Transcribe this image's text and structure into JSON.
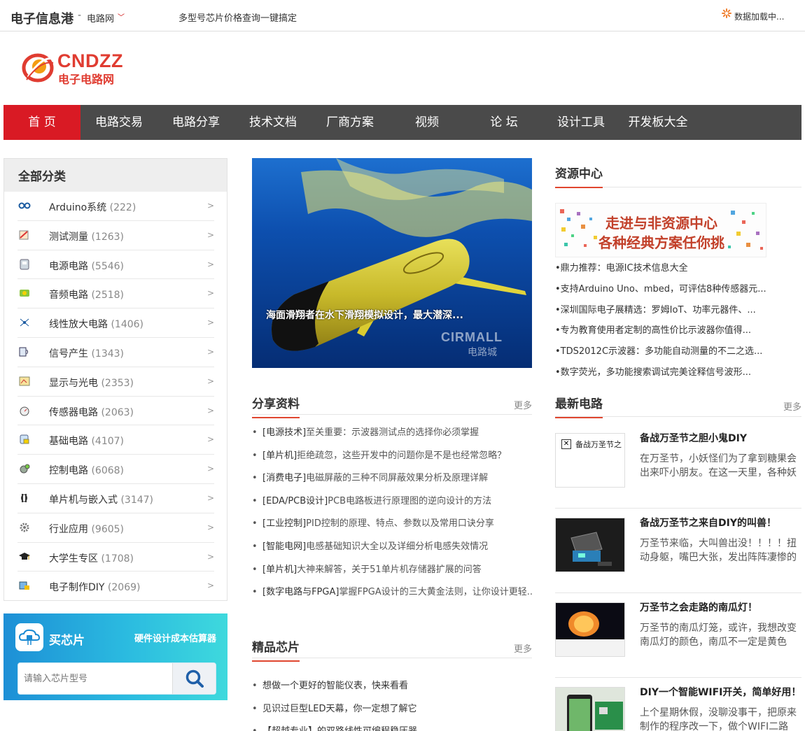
{
  "topbar": {
    "brand": "电子信息港",
    "separator": "-",
    "sub": "电路网",
    "promo": "多型号芯片价格查询一键搞定",
    "loading": "数据加载中..."
  },
  "logo": {
    "en": "CNDZZ",
    "cn": "电子电路网"
  },
  "nav": [
    "首 页",
    "电路交易",
    "电路分享",
    "技术文档",
    "厂商方案",
    "视频",
    "论 坛",
    "设计工具",
    "开发板大全"
  ],
  "categories": {
    "title": "全部分类",
    "items": [
      {
        "name": "Arduino系统",
        "count": "(222)"
      },
      {
        "name": "测试测量",
        "count": "(1263)"
      },
      {
        "name": "电源电路",
        "count": "(5546)"
      },
      {
        "name": "音频电路",
        "count": "(2518)"
      },
      {
        "name": "线性放大电路",
        "count": "(1406)"
      },
      {
        "name": "信号产生",
        "count": "(1343)"
      },
      {
        "name": "显示与光电",
        "count": "(2353)"
      },
      {
        "name": "传感器电路",
        "count": "(2063)"
      },
      {
        "name": "基础电路",
        "count": "(4107)"
      },
      {
        "name": "控制电路",
        "count": "(6068)"
      },
      {
        "name": "单片机与嵌入式",
        "count": "(3147)"
      },
      {
        "name": "行业应用",
        "count": "(9605)"
      },
      {
        "name": "大学生专区",
        "count": "(1708)"
      },
      {
        "name": "电子制作DIY",
        "count": "(2069)"
      }
    ],
    "arrow": ">"
  },
  "chips": {
    "title": "买芯片",
    "subtitle": "硬件设计成本估算器",
    "placeholder": "请输入芯片型号"
  },
  "hero": {
    "caption": "海面滑翔者在水下滑翔模拟设计，最大潜深...",
    "watermark_en": "CIRMALL",
    "watermark_cn": "电路城"
  },
  "share": {
    "title": "分享资料",
    "more": "更多",
    "items": [
      {
        "cat": "[电源技术]",
        "text": "至关重要：示波器测试点的选择你必须掌握"
      },
      {
        "cat": "[单片机]",
        "text": "拒绝疏忽，这些开发中的问题你是不是也经常忽略？"
      },
      {
        "cat": "[消费电子]",
        "text": "电磁屏蔽的三种不同屏蔽效果分析及原理详解"
      },
      {
        "cat": "[EDA/PCB设计]",
        "text": "PCB电路板进行原理图的逆向设计的方法"
      },
      {
        "cat": "[工业控制]",
        "text": "PID控制的原理、特点、参数以及常用口诀分享"
      },
      {
        "cat": "[智能电网]",
        "text": "电感基础知识大全以及详细分析电感失效情况"
      },
      {
        "cat": "[单片机]",
        "text": "大神来解答，关于51单片机存储器扩展的问答"
      },
      {
        "cat": "[数字电路与FPGA]",
        "text": "掌握FPGA设计的三大黄金法则，让你设计更轻..."
      }
    ]
  },
  "chips_section": {
    "title": "精品芯片",
    "more": "更多",
    "items": [
      "想做一个更好的智能仪表，快来看看",
      "见识过巨型LED天幕，你一定想了解它",
      "【超越专业】的双路线性可编程稳压器"
    ]
  },
  "resource": {
    "title": "资源中心",
    "banner_line1": "走进与非资源中心",
    "banner_line2": "各种经典方案任你挑",
    "items": [
      "•鼎力推荐：电源IC技术信息大全",
      "•支持Arduino Uno、mbed，可评估8种传感器元...",
      "•深圳国际电子展精选：罗姆IoT、功率元器件、...",
      "•专为教育使用者定制的高性价比示波器你值得...",
      "•TDS2012C示波器：多功能自动测量的不二之选...",
      "•数字荧光，多功能搜索调试完美诠释信号波形..."
    ]
  },
  "latest": {
    "title": "最新电路",
    "more": "更多",
    "items": [
      {
        "title": "备战万圣节之胆小鬼DIY",
        "desc": "在万圣节，小妖怪们为了拿到糖果会出来吓小朋友。在这一天里，各种妖",
        "thumb_alt": "备战万圣节之"
      },
      {
        "title": "备战万圣节之来自DIY的叫兽！",
        "desc": "万圣节来临，大叫兽出没！！！！扭动身躯，嘴巴大张，发出阵阵凄惨的"
      },
      {
        "title": "万圣节之会走路的南瓜灯！",
        "desc": "万圣节的南瓜灯笼，或许，我想改变南瓜灯的颜色，南瓜不一定是黄色"
      },
      {
        "title": "DIY一个智能WIFI开关，简单好用！",
        "desc": "上个星期休假，没聊没事干，把原来制作的程序改一下，做个WIFI二路开"
      }
    ]
  }
}
